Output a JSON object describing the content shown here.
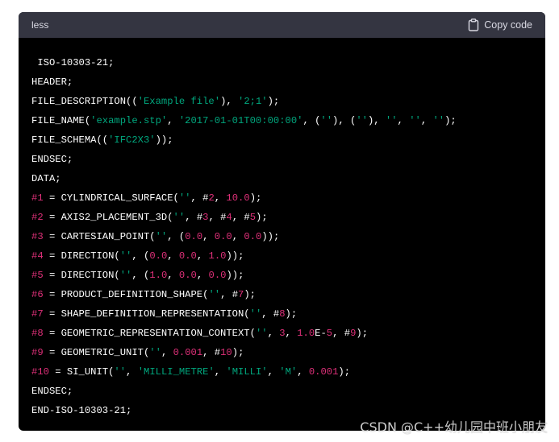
{
  "code_block": {
    "language": "less",
    "copy_label": "Copy code",
    "copy_icon": "clipboard-icon",
    "colors": {
      "background": "#000000",
      "header_background": "#343541",
      "plain": "#ffffff",
      "string": "#00a67d",
      "number": "#df3079"
    },
    "lines": [
      [
        {
          "t": " ISO-10303-21;",
          "c": "plain"
        }
      ],
      [
        {
          "t": "HEADER;",
          "c": "plain"
        }
      ],
      [
        {
          "t": "FILE_DESCRIPTION((",
          "c": "plain"
        },
        {
          "t": "'Example file'",
          "c": "string"
        },
        {
          "t": "), ",
          "c": "plain"
        },
        {
          "t": "'2;1'",
          "c": "string"
        },
        {
          "t": ");",
          "c": "plain"
        }
      ],
      [
        {
          "t": "FILE_NAME(",
          "c": "plain"
        },
        {
          "t": "'example.stp'",
          "c": "string"
        },
        {
          "t": ", ",
          "c": "plain"
        },
        {
          "t": "'2017-01-01T00:00:00'",
          "c": "string"
        },
        {
          "t": ", (",
          "c": "plain"
        },
        {
          "t": "''",
          "c": "string"
        },
        {
          "t": "), (",
          "c": "plain"
        },
        {
          "t": "''",
          "c": "string"
        },
        {
          "t": "), ",
          "c": "plain"
        },
        {
          "t": "''",
          "c": "string"
        },
        {
          "t": ", ",
          "c": "plain"
        },
        {
          "t": "''",
          "c": "string"
        },
        {
          "t": ", ",
          "c": "plain"
        },
        {
          "t": "''",
          "c": "string"
        },
        {
          "t": ");",
          "c": "plain"
        }
      ],
      [
        {
          "t": "FILE_SCHEMA((",
          "c": "plain"
        },
        {
          "t": "'IFC2X3'",
          "c": "string"
        },
        {
          "t": "));",
          "c": "plain"
        }
      ],
      [
        {
          "t": "ENDSEC;",
          "c": "plain"
        }
      ],
      [
        {
          "t": "DATA;",
          "c": "plain"
        }
      ],
      [
        {
          "t": "#1",
          "c": "ref"
        },
        {
          "t": " = CYLINDRICAL_SURFACE(",
          "c": "plain"
        },
        {
          "t": "''",
          "c": "string"
        },
        {
          "t": ", #",
          "c": "plain"
        },
        {
          "t": "2",
          "c": "number"
        },
        {
          "t": ", ",
          "c": "plain"
        },
        {
          "t": "10.0",
          "c": "number"
        },
        {
          "t": ");",
          "c": "plain"
        }
      ],
      [
        {
          "t": "#2",
          "c": "ref"
        },
        {
          "t": " = AXIS2_PLACEMENT_3D(",
          "c": "plain"
        },
        {
          "t": "''",
          "c": "string"
        },
        {
          "t": ", #",
          "c": "plain"
        },
        {
          "t": "3",
          "c": "number"
        },
        {
          "t": ", #",
          "c": "plain"
        },
        {
          "t": "4",
          "c": "number"
        },
        {
          "t": ", #",
          "c": "plain"
        },
        {
          "t": "5",
          "c": "number"
        },
        {
          "t": ");",
          "c": "plain"
        }
      ],
      [
        {
          "t": "#3",
          "c": "ref"
        },
        {
          "t": " = CARTESIAN_POINT(",
          "c": "plain"
        },
        {
          "t": "''",
          "c": "string"
        },
        {
          "t": ", (",
          "c": "plain"
        },
        {
          "t": "0.0",
          "c": "number"
        },
        {
          "t": ", ",
          "c": "plain"
        },
        {
          "t": "0.0",
          "c": "number"
        },
        {
          "t": ", ",
          "c": "plain"
        },
        {
          "t": "0.0",
          "c": "number"
        },
        {
          "t": "));",
          "c": "plain"
        }
      ],
      [
        {
          "t": "#4",
          "c": "ref"
        },
        {
          "t": " = DIRECTION(",
          "c": "plain"
        },
        {
          "t": "''",
          "c": "string"
        },
        {
          "t": ", (",
          "c": "plain"
        },
        {
          "t": "0.0",
          "c": "number"
        },
        {
          "t": ", ",
          "c": "plain"
        },
        {
          "t": "0.0",
          "c": "number"
        },
        {
          "t": ", ",
          "c": "plain"
        },
        {
          "t": "1.0",
          "c": "number"
        },
        {
          "t": "));",
          "c": "plain"
        }
      ],
      [
        {
          "t": "#5",
          "c": "ref"
        },
        {
          "t": " = DIRECTION(",
          "c": "plain"
        },
        {
          "t": "''",
          "c": "string"
        },
        {
          "t": ", (",
          "c": "plain"
        },
        {
          "t": "1.0",
          "c": "number"
        },
        {
          "t": ", ",
          "c": "plain"
        },
        {
          "t": "0.0",
          "c": "number"
        },
        {
          "t": ", ",
          "c": "plain"
        },
        {
          "t": "0.0",
          "c": "number"
        },
        {
          "t": "));",
          "c": "plain"
        }
      ],
      [
        {
          "t": "#6",
          "c": "ref"
        },
        {
          "t": " = PRODUCT_DEFINITION_SHAPE(",
          "c": "plain"
        },
        {
          "t": "''",
          "c": "string"
        },
        {
          "t": ", #",
          "c": "plain"
        },
        {
          "t": "7",
          "c": "number"
        },
        {
          "t": ");",
          "c": "plain"
        }
      ],
      [
        {
          "t": "#7",
          "c": "ref"
        },
        {
          "t": " = SHAPE_DEFINITION_REPRESENTATION(",
          "c": "plain"
        },
        {
          "t": "''",
          "c": "string"
        },
        {
          "t": ", #",
          "c": "plain"
        },
        {
          "t": "8",
          "c": "number"
        },
        {
          "t": ");",
          "c": "plain"
        }
      ],
      [
        {
          "t": "#8",
          "c": "ref"
        },
        {
          "t": " = GEOMETRIC_REPRESENTATION_CONTEXT(",
          "c": "plain"
        },
        {
          "t": "''",
          "c": "string"
        },
        {
          "t": ", ",
          "c": "plain"
        },
        {
          "t": "3",
          "c": "number"
        },
        {
          "t": ", ",
          "c": "plain"
        },
        {
          "t": "1.0",
          "c": "number"
        },
        {
          "t": "E-",
          "c": "plain"
        },
        {
          "t": "5",
          "c": "number"
        },
        {
          "t": ", #",
          "c": "plain"
        },
        {
          "t": "9",
          "c": "number"
        },
        {
          "t": ");",
          "c": "plain"
        }
      ],
      [
        {
          "t": "#9",
          "c": "ref"
        },
        {
          "t": " = GEOMETRIC_UNIT(",
          "c": "plain"
        },
        {
          "t": "''",
          "c": "string"
        },
        {
          "t": ", ",
          "c": "plain"
        },
        {
          "t": "0.001",
          "c": "number"
        },
        {
          "t": ", #",
          "c": "plain"
        },
        {
          "t": "10",
          "c": "number"
        },
        {
          "t": ");",
          "c": "plain"
        }
      ],
      [
        {
          "t": "#10",
          "c": "ref"
        },
        {
          "t": " = SI_UNIT(",
          "c": "plain"
        },
        {
          "t": "''",
          "c": "string"
        },
        {
          "t": ", ",
          "c": "plain"
        },
        {
          "t": "'MILLI_METRE'",
          "c": "string"
        },
        {
          "t": ", ",
          "c": "plain"
        },
        {
          "t": "'MILLI'",
          "c": "string"
        },
        {
          "t": ", ",
          "c": "plain"
        },
        {
          "t": "'M'",
          "c": "string"
        },
        {
          "t": ", ",
          "c": "plain"
        },
        {
          "t": "0.001",
          "c": "number"
        },
        {
          "t": ");",
          "c": "plain"
        }
      ],
      [
        {
          "t": "ENDSEC;",
          "c": "plain"
        }
      ],
      [
        {
          "t": "END-ISO-10303-21;",
          "c": "plain"
        }
      ]
    ]
  },
  "watermark": "CSDN @C++幼儿园中班小朋友"
}
